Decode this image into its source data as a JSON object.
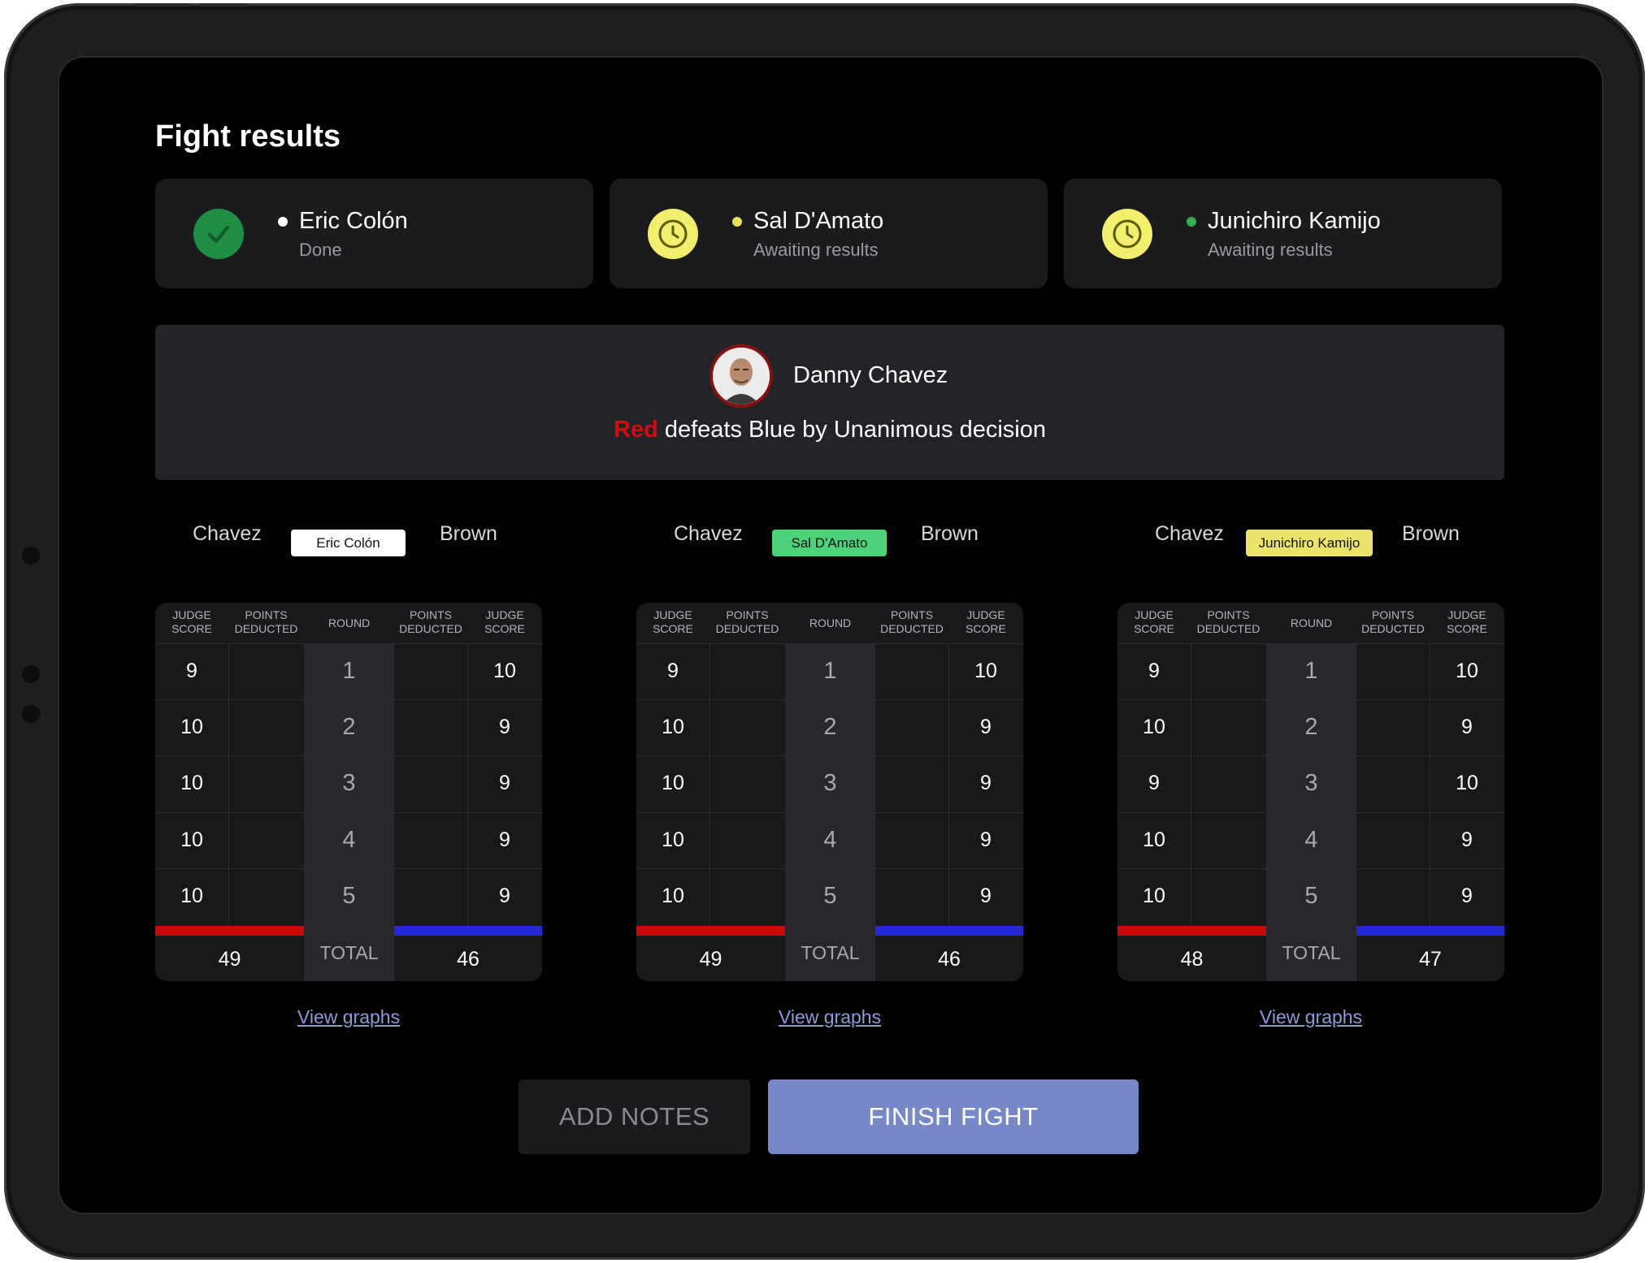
{
  "page": {
    "title": "Fight results"
  },
  "judges": [
    {
      "name": "Eric Colón",
      "status": "Done",
      "state": "done",
      "dot_color": "#ffffff"
    },
    {
      "name": "Sal D'Amato",
      "status": "Awaiting results",
      "state": "waiting",
      "dot_color": "#e6e25a"
    },
    {
      "name": "Junichiro Kamijo",
      "status": "Awaiting results",
      "state": "waiting",
      "dot_color": "#2fb24f"
    }
  ],
  "winner": {
    "name": "Danny Chavez",
    "corner_word": "Red",
    "result_rest": " defeats Blue by Unanimous decision"
  },
  "table_headers": {
    "judge_score": [
      "JUDGE",
      "SCORE"
    ],
    "points_deducted": [
      "POINTS",
      "DEDUCTED"
    ],
    "round": "ROUND",
    "total": "TOTAL"
  },
  "scorecards": [
    {
      "red_fighter": "Chavez",
      "blue_fighter": "Brown",
      "judge": "Eric Colón",
      "badge_color": "#ffffff",
      "rounds": [
        1,
        2,
        3,
        4,
        5
      ],
      "red_scores": [
        9,
        10,
        10,
        10,
        10
      ],
      "blue_scores": [
        10,
        9,
        9,
        9,
        9
      ],
      "red_total": 49,
      "blue_total": 46,
      "link": "View graphs"
    },
    {
      "red_fighter": "Chavez",
      "blue_fighter": "Brown",
      "judge": "Sal D'Amato",
      "badge_color": "#4cd37a",
      "rounds": [
        1,
        2,
        3,
        4,
        5
      ],
      "red_scores": [
        9,
        10,
        10,
        10,
        10
      ],
      "blue_scores": [
        10,
        9,
        9,
        9,
        9
      ],
      "red_total": 49,
      "blue_total": 46,
      "link": "View graphs"
    },
    {
      "red_fighter": "Chavez",
      "blue_fighter": "Brown",
      "judge": "Junichiro Kamijo",
      "badge_color": "#ece36a",
      "rounds": [
        1,
        2,
        3,
        4,
        5
      ],
      "red_scores": [
        9,
        10,
        9,
        10,
        10
      ],
      "blue_scores": [
        10,
        9,
        10,
        9,
        9
      ],
      "red_total": 48,
      "blue_total": 47,
      "link": "View graphs"
    }
  ],
  "actions": {
    "add_notes": "ADD NOTES",
    "finish_fight": "FINISH FIGHT"
  },
  "colors": {
    "red_corner": "#cc0a0a",
    "blue_corner": "#2428d8",
    "accent": "#7688c8"
  }
}
